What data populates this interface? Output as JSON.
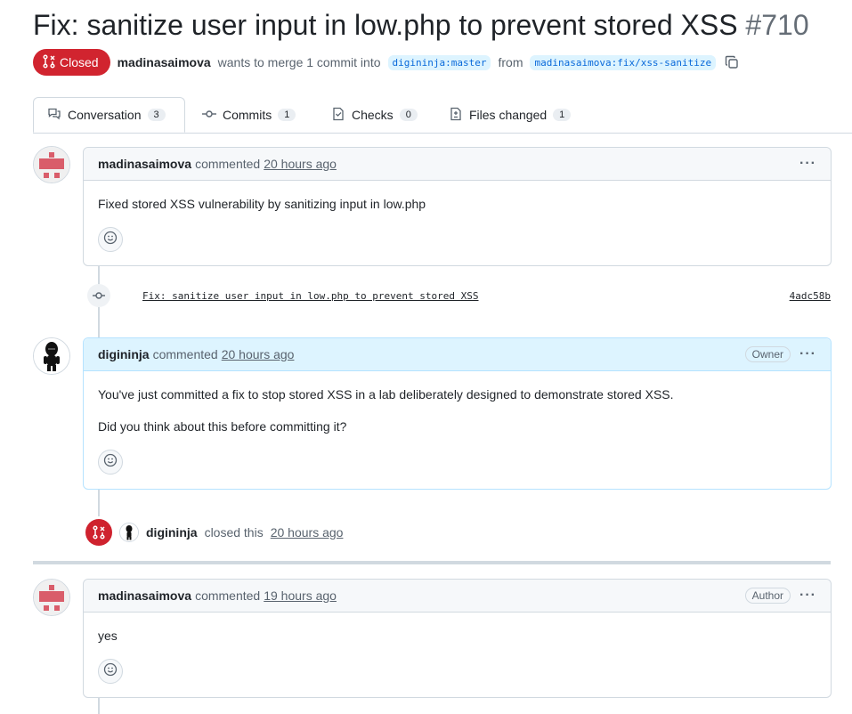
{
  "pr": {
    "title": "Fix: sanitize user input in low.php to prevent stored XSS",
    "number": "#710",
    "state": "Closed",
    "author": "madinasaimova",
    "merge_text": "wants to merge 1 commit into",
    "base_branch": "digininja:master",
    "from_text": "from",
    "head_branch": "madinasaimova:fix/xss-sanitize"
  },
  "tabs": [
    {
      "label": "Conversation",
      "count": "3",
      "icon": "comment-discussion-icon"
    },
    {
      "label": "Commits",
      "count": "1",
      "icon": "git-commit-icon"
    },
    {
      "label": "Checks",
      "count": "0",
      "icon": "checklist-icon"
    },
    {
      "label": "Files changed",
      "count": "1",
      "icon": "file-diff-icon"
    }
  ],
  "comments": [
    {
      "author": "madinasaimova",
      "verb": "commented",
      "time": "20 hours ago",
      "role": "",
      "body": [
        "Fixed stored XSS vulnerability by sanitizing input in low.php"
      ]
    },
    {
      "author": "digininja",
      "verb": "commented",
      "time": "20 hours ago",
      "role": "Owner",
      "body": [
        "You've just committed a fix to stop stored XSS in a lab deliberately designed to demonstrate stored XSS.",
        "Did you think about this before committing it?"
      ]
    },
    {
      "author": "madinasaimova",
      "verb": "commented",
      "time": "19 hours ago",
      "role": "Author",
      "body": [
        "yes"
      ]
    }
  ],
  "commit": {
    "message": "Fix: sanitize user input in low.php to prevent stored XSS",
    "sha": "4adc58b"
  },
  "closed_event": {
    "actor": "digininja",
    "text": "closed this",
    "time": "20 hours ago"
  },
  "colors": {
    "closed": "#d1242f",
    "owner_header": "#ddf4ff",
    "link": "#0969da"
  }
}
